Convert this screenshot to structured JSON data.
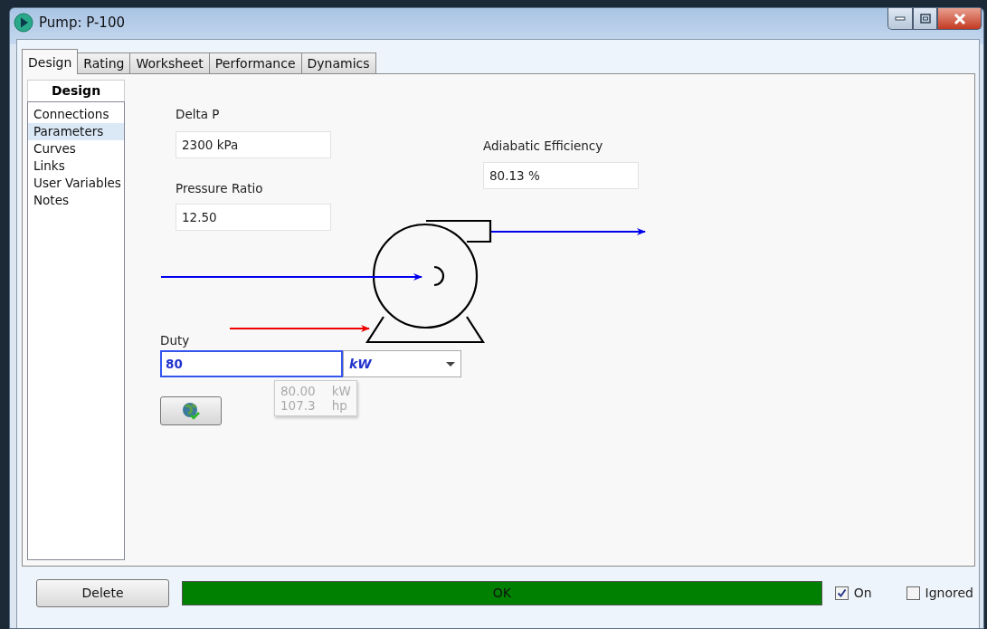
{
  "window": {
    "title": "Pump: P-100"
  },
  "tabs": [
    {
      "label": "Design",
      "selected": true
    },
    {
      "label": "Rating",
      "selected": false
    },
    {
      "label": "Worksheet",
      "selected": false
    },
    {
      "label": "Performance",
      "selected": false
    },
    {
      "label": "Dynamics",
      "selected": false
    }
  ],
  "sidebar": {
    "title": "Design",
    "items": [
      {
        "label": "Connections",
        "selected": false
      },
      {
        "label": "Parameters",
        "selected": true
      },
      {
        "label": "Curves",
        "selected": false
      },
      {
        "label": "Links",
        "selected": false
      },
      {
        "label": "User Variables",
        "selected": false
      },
      {
        "label": "Notes",
        "selected": false
      }
    ]
  },
  "parameters": {
    "delta_p": {
      "label": "Delta P",
      "value": "2300 kPa"
    },
    "pressure_ratio": {
      "label": "Pressure Ratio",
      "value": "12.50"
    },
    "adiabatic_efficiency": {
      "label": "Adiabatic Efficiency",
      "value": "80.13 %"
    },
    "duty": {
      "label": "Duty",
      "value": "80",
      "unit": "kW"
    },
    "duty_tooltip": [
      {
        "value": "80.00",
        "unit": "kW"
      },
      {
        "value": "107.3",
        "unit": "hp"
      }
    ]
  },
  "footer": {
    "delete_button": "Delete",
    "status": "OK",
    "on": {
      "label": "On",
      "checked": true
    },
    "ignored": {
      "label": "Ignored",
      "checked": false
    }
  }
}
